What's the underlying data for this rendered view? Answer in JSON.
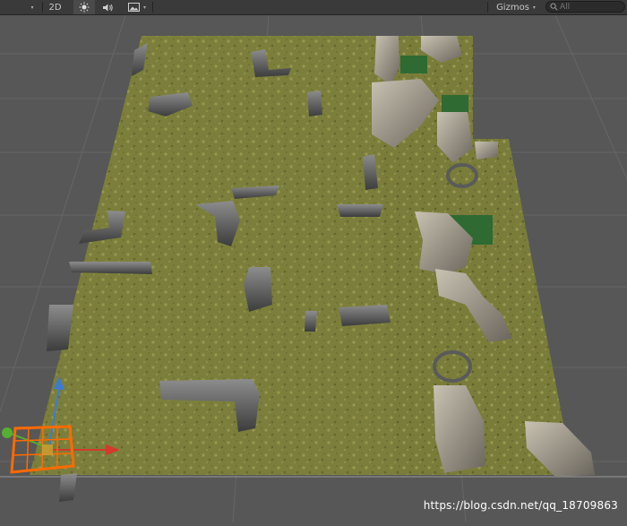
{
  "toolbar": {
    "menu_arrow": "▾",
    "mode_2d_label": "2D",
    "lighting_icon": "sun-icon",
    "audio_icon": "speaker-icon",
    "effects_icon": "image-icon",
    "gizmos_label": "Gizmos",
    "gizmos_arrow": "▾",
    "search_placeholder": "All"
  },
  "watermark": "https://blog.csdn.net/qq_18709863",
  "colors": {
    "viewport_background": "#575757",
    "terrain_green": "#7a7d3a",
    "rock_gray": "#5e5e5e",
    "gizmo_x_axis": "#d33a2c",
    "gizmo_y_axis": "#3a7bd5",
    "gizmo_z_axis": "#55b030",
    "selection_orange": "#ff6a00"
  }
}
